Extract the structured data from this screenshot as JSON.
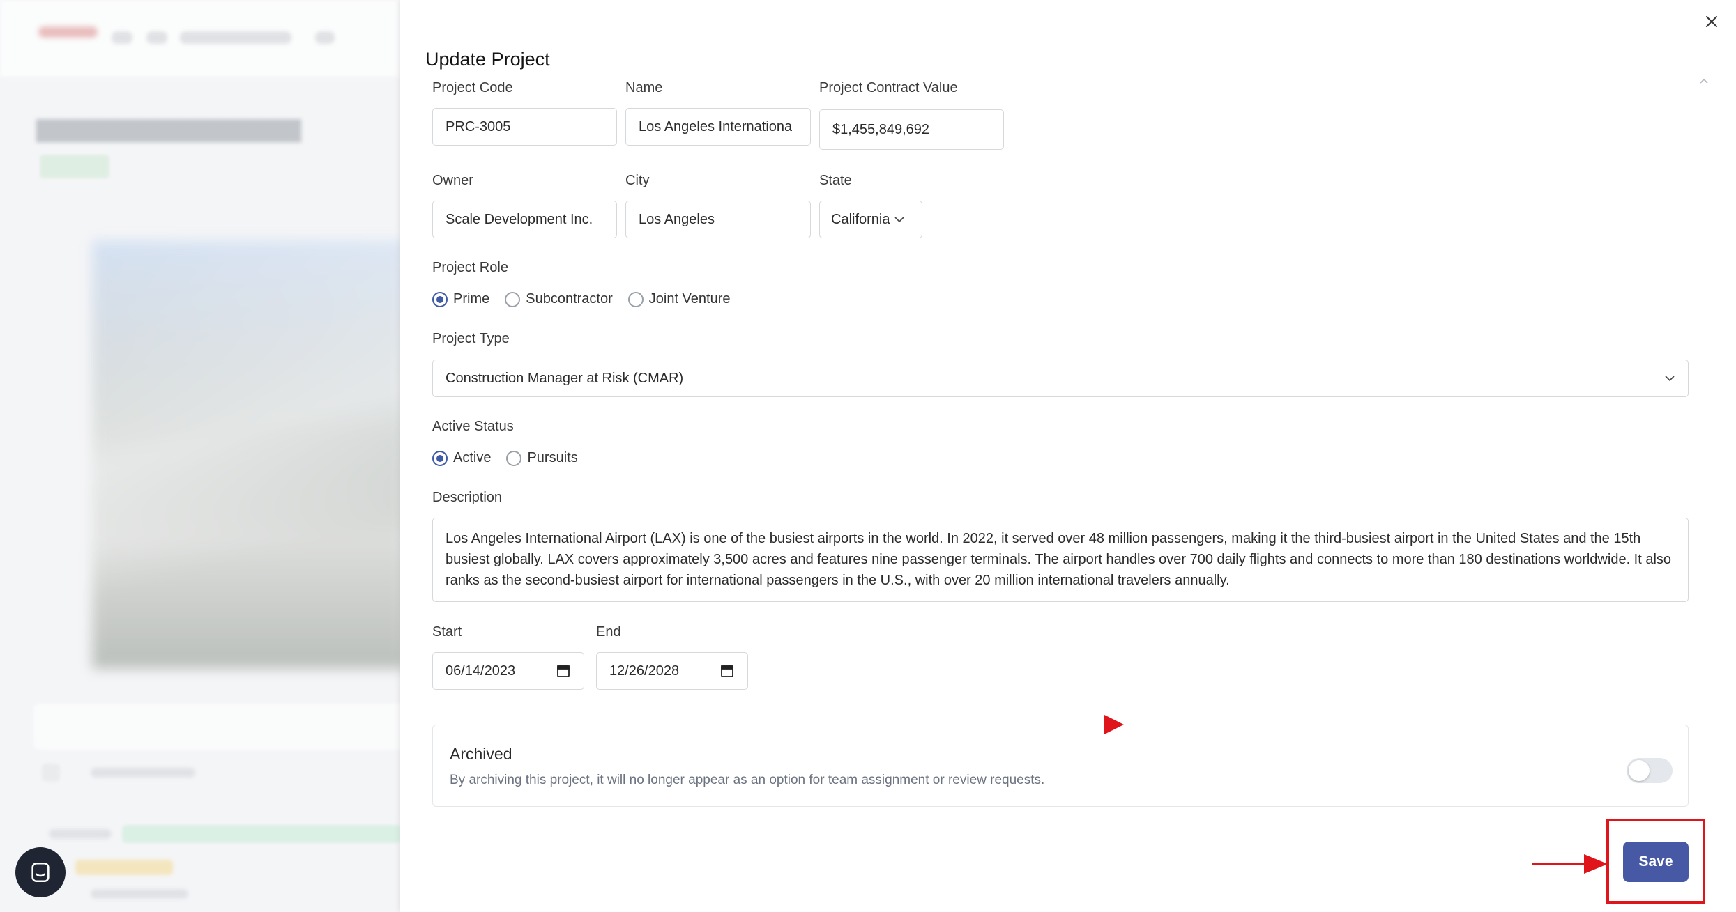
{
  "drawer": {
    "title": "Update Project"
  },
  "fields": {
    "project_code": {
      "label": "Project Code",
      "value": "PRC-3005"
    },
    "name": {
      "label": "Name",
      "value": "Los Angeles Internationa"
    },
    "contract_value": {
      "label": "Project Contract Value",
      "value": "$1,455,849,692"
    },
    "owner": {
      "label": "Owner",
      "value": "Scale Development Inc."
    },
    "city": {
      "label": "City",
      "value": "Los Angeles"
    },
    "state": {
      "label": "State",
      "value": "California"
    }
  },
  "project_role": {
    "label": "Project Role",
    "options": [
      {
        "label": "Prime",
        "selected": true
      },
      {
        "label": "Subcontractor",
        "selected": false
      },
      {
        "label": "Joint Venture",
        "selected": false
      }
    ]
  },
  "project_type": {
    "label": "Project Type",
    "value": "Construction Manager at Risk (CMAR)"
  },
  "active_status": {
    "label": "Active Status",
    "options": [
      {
        "label": "Active",
        "selected": true
      },
      {
        "label": "Pursuits",
        "selected": false
      }
    ]
  },
  "description": {
    "label": "Description",
    "value": "Los Angeles International Airport (LAX) is one of the busiest airports in the world. In 2022, it served over 48 million passengers, making it the third-busiest airport in the United States and the 15th busiest globally. LAX covers approximately 3,500 acres and features nine passenger terminals. The airport handles over 700 daily flights and connects to more than 180 destinations worldwide. It also ranks as the second-busiest airport for international passengers in the U.S., with over 20 million international travelers annually."
  },
  "dates": {
    "start": {
      "label": "Start",
      "value": "06/14/2023"
    },
    "end": {
      "label": "End",
      "value": "12/26/2028"
    }
  },
  "archived": {
    "title": "Archived",
    "description": "By archiving this project, it will no longer appear as an option for team assignment or review requests.",
    "on": false
  },
  "actions": {
    "save_label": "Save"
  },
  "colors": {
    "primary": "#4759a5",
    "highlight": "#e0151b"
  }
}
